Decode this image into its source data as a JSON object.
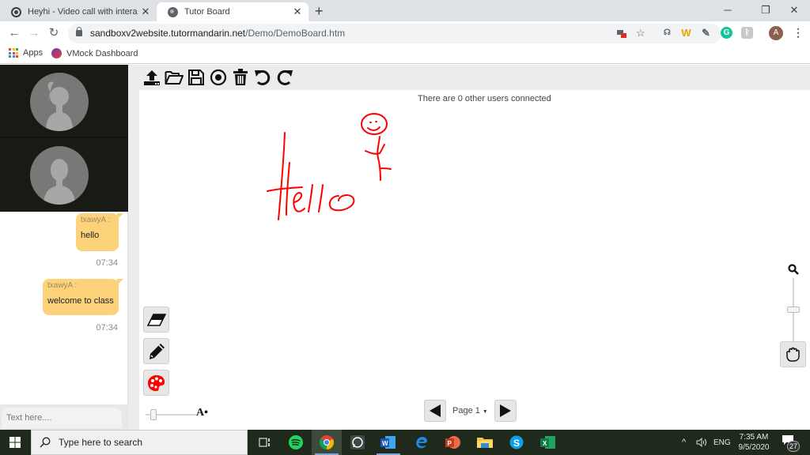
{
  "browser": {
    "tabs": [
      {
        "title": "Heyhi - Video call with interactive",
        "icon": "record-icon",
        "active": false
      },
      {
        "title": "Tutor Board",
        "icon": "globe-icon",
        "active": true
      }
    ],
    "new_tab": "+",
    "window_controls": {
      "minimize": "─",
      "restore": "❐",
      "close": "✕"
    },
    "nav": {
      "back": "←",
      "forward": "→",
      "reload": "↻"
    },
    "url_host": "sandboxv2website.tutormandarin.net",
    "url_path": "/Demo/DemoBoard.htm",
    "star": "☆",
    "profile_initial": "A",
    "menu": "⋮",
    "bookmarks": [
      {
        "label": "Apps",
        "icon": "apps-grid-icon"
      },
      {
        "label": "VMock Dashboard",
        "icon": "vmock-icon"
      }
    ]
  },
  "chat": {
    "messages": [
      {
        "sender": "txawyA :",
        "text": "hello",
        "time": "07:34"
      },
      {
        "sender": "txawyA :",
        "text": "welcome to class",
        "time": "07:34"
      }
    ],
    "input_placeholder": "Text here...."
  },
  "board": {
    "toolbar": [
      {
        "name": "upload-icon",
        "label": "Upload"
      },
      {
        "name": "open-folder-icon",
        "label": "Open"
      },
      {
        "name": "save-icon",
        "label": "Save"
      },
      {
        "name": "record-icon",
        "label": "Record"
      },
      {
        "name": "trash-icon",
        "label": "Clear"
      },
      {
        "name": "undo-icon",
        "label": "Undo"
      },
      {
        "name": "redo-icon",
        "label": "Redo"
      }
    ],
    "status": "There are 0 other users connected",
    "drawing_color": "#ff0000",
    "drawing_text": "Hello",
    "tools": [
      "eraser",
      "pencil",
      "palette"
    ],
    "palette_color": "#ff0000",
    "font_size_label": "A",
    "page_label": "Page 1",
    "page_caret": "▼",
    "zoom_level_fraction": 0.5
  },
  "taskbar": {
    "search_placeholder": "Type here to search",
    "apps": [
      "task-view",
      "spotify",
      "chrome",
      "whatsapp",
      "word",
      "edge",
      "powerpoint",
      "file-explorer",
      "skype",
      "excel"
    ],
    "language": "ENG",
    "time": "7:35 AM",
    "date": "9/5/2020",
    "notifications": "27"
  }
}
